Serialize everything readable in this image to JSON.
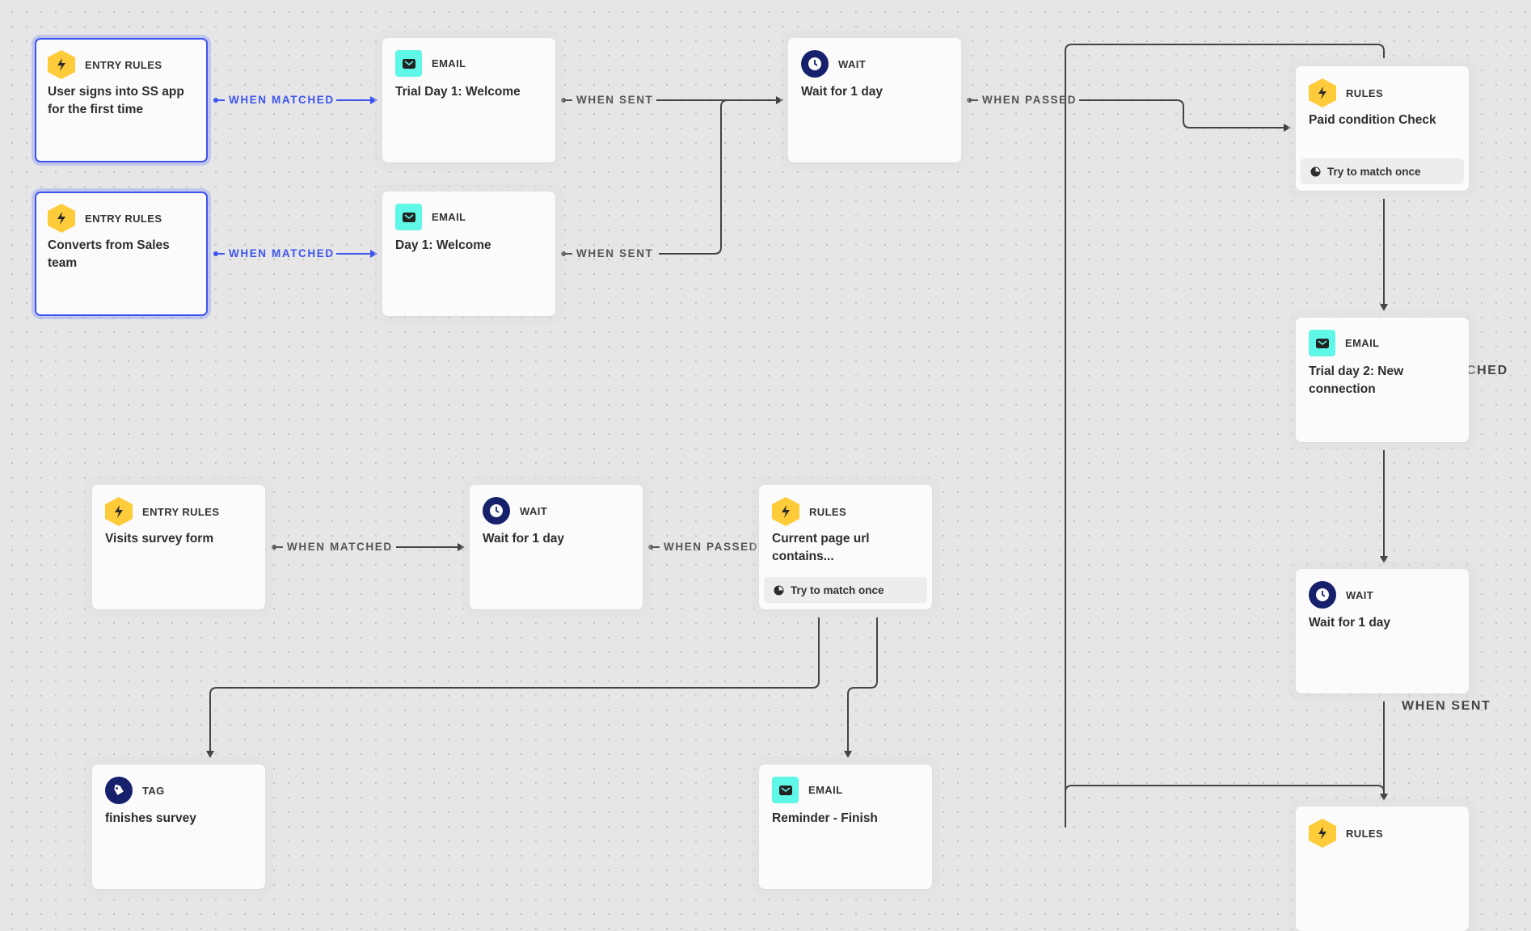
{
  "colors": {
    "accent_blue": "#3d54f0",
    "rules_yellow": "#fecb3a",
    "email_cyan": "#5ff7e8",
    "wait_navy": "#16206b",
    "wire": "#444444"
  },
  "nodes": [
    {
      "id": "entry1",
      "type": "ENTRY RULES",
      "icon": "lightning-icon",
      "title": "User signs into SS app for the first time",
      "selected": true
    },
    {
      "id": "entry2",
      "type": "ENTRY RULES",
      "icon": "lightning-icon",
      "title": "Converts from Sales team",
      "selected": true
    },
    {
      "id": "email1",
      "type": "EMAIL",
      "icon": "envelope-icon",
      "title": "Trial Day 1: Welcome"
    },
    {
      "id": "email2",
      "type": "EMAIL",
      "icon": "envelope-icon",
      "title": "Day 1: Welcome"
    },
    {
      "id": "wait1",
      "type": "WAIT",
      "icon": "clock-icon",
      "title": "Wait for 1 day"
    },
    {
      "id": "rules_paid",
      "type": "RULES",
      "icon": "lightning-icon",
      "title": "Paid condition Check",
      "footer": "Try to match once"
    },
    {
      "id": "email_trial2",
      "type": "EMAIL",
      "icon": "envelope-icon",
      "title": "Trial day 2: New connection"
    },
    {
      "id": "wait_right",
      "type": "WAIT",
      "icon": "clock-icon",
      "title": "Wait for 1 day"
    },
    {
      "id": "rules_bottom",
      "type": "RULES",
      "icon": "lightning-icon",
      "title": ""
    },
    {
      "id": "entry3",
      "type": "ENTRY RULES",
      "icon": "lightning-icon",
      "title": "Visits survey form"
    },
    {
      "id": "wait2",
      "type": "WAIT",
      "icon": "clock-icon",
      "title": "Wait for 1 day"
    },
    {
      "id": "rules_url",
      "type": "RULES",
      "icon": "lightning-icon",
      "title": "Current page url contains...",
      "footer": "Try to match once"
    },
    {
      "id": "tag",
      "type": "TAG",
      "icon": "tag-icon",
      "title": "finishes survey"
    },
    {
      "id": "email_reminder",
      "type": "EMAIL",
      "icon": "envelope-icon",
      "title": "Reminder - Finish"
    }
  ],
  "edge_labels": {
    "when_matched_1": "WHEN MATCHED",
    "when_matched_2": "WHEN MATCHED",
    "when_sent_1": "WHEN SENT",
    "when_sent_2": "WHEN SENT",
    "when_passed_1": "WHEN PASSED",
    "when_matched_3": "WHEN MATCHED",
    "when_passed_2": "WHEN PASSED",
    "when_matched_partial": "CHED",
    "when_sent_right": "WHEN SENT"
  }
}
